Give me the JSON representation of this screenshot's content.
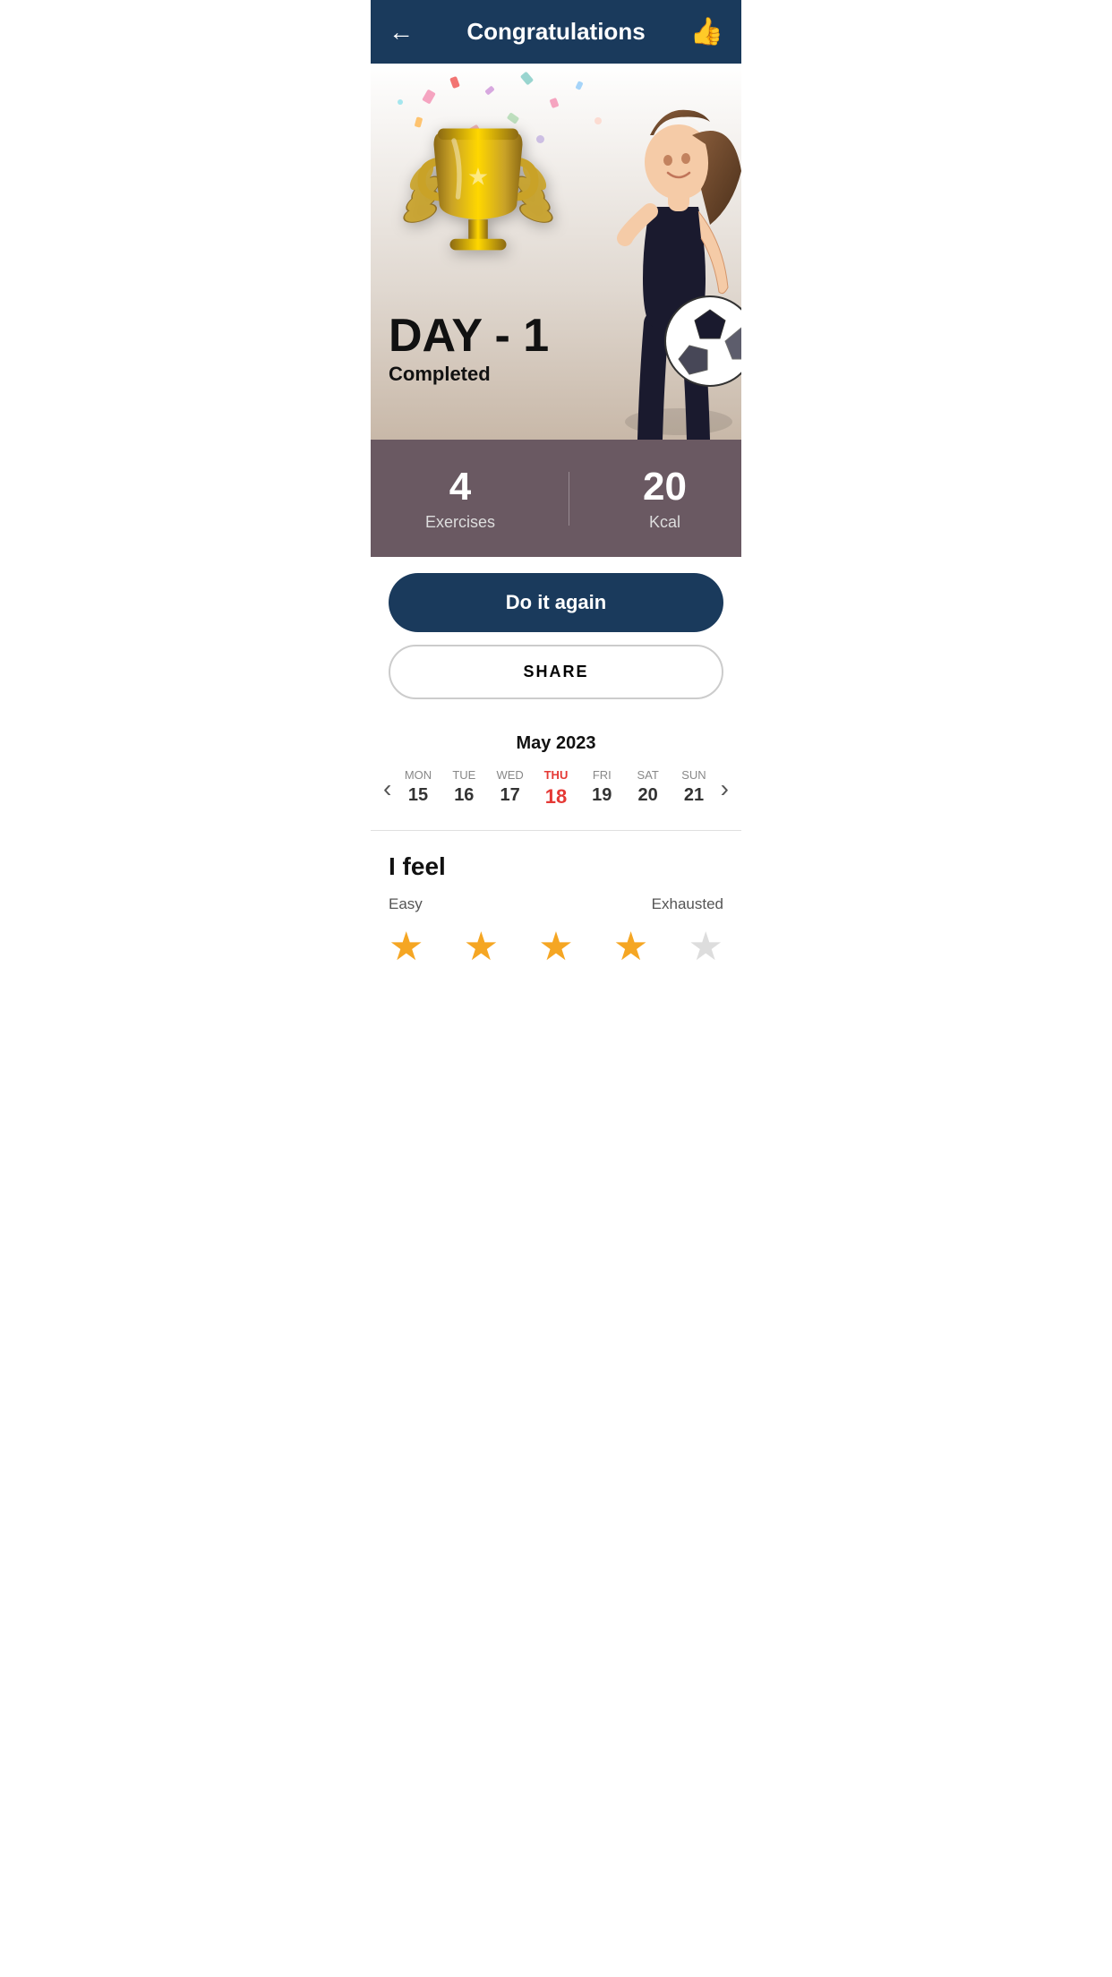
{
  "header": {
    "title": "Congratulations",
    "back_icon": "←",
    "thumbs_icon": "👍"
  },
  "hero": {
    "day_label": "DAY - 1",
    "completed_label": "Completed"
  },
  "stats": {
    "exercises_count": "4",
    "exercises_label": "Exercises",
    "kcal_count": "20",
    "kcal_label": "Kcal"
  },
  "buttons": {
    "do_again_label": "Do it again",
    "share_label": "SHARE"
  },
  "calendar": {
    "month_year": "May 2023",
    "days": [
      {
        "name": "MON",
        "num": "15",
        "active": false
      },
      {
        "name": "TUE",
        "num": "16",
        "active": false
      },
      {
        "name": "WED",
        "num": "17",
        "active": false
      },
      {
        "name": "THU",
        "num": "18",
        "active": true
      },
      {
        "name": "FRI",
        "num": "19",
        "active": false
      },
      {
        "name": "SAT",
        "num": "20",
        "active": false
      },
      {
        "name": "SUN",
        "num": "21",
        "active": false
      }
    ]
  },
  "feel": {
    "title": "I feel",
    "label_left": "Easy",
    "label_right": "Exhausted",
    "stars": [
      true,
      true,
      true,
      true,
      false
    ]
  }
}
